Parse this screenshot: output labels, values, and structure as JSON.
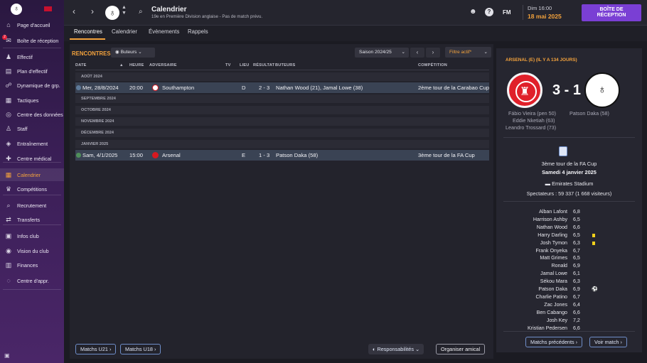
{
  "sidebar": {
    "items": [
      {
        "label": "Page d'accueil",
        "icon": "home-icon",
        "glyph": "⌂"
      },
      {
        "label": "Boîte de réception",
        "icon": "inbox-icon",
        "glyph": "✉",
        "badge": "2"
      },
      {
        "label": "Effectif",
        "icon": "squad-icon",
        "glyph": "♟"
      },
      {
        "label": "Plan d'effectif",
        "icon": "squad-plan-icon",
        "glyph": "▤"
      },
      {
        "label": "Dynamique de grp.",
        "icon": "dynamics-icon",
        "glyph": "☍"
      },
      {
        "label": "Tactiques",
        "icon": "tactics-icon",
        "glyph": "▦"
      },
      {
        "label": "Centre des données",
        "icon": "data-icon",
        "glyph": "◎"
      },
      {
        "label": "Staff",
        "icon": "staff-icon",
        "glyph": "♙"
      },
      {
        "label": "Entraînement",
        "icon": "training-icon",
        "glyph": "◈"
      },
      {
        "label": "Centre médical",
        "icon": "medical-icon",
        "glyph": "✚"
      },
      {
        "label": "Calendrier",
        "icon": "calendar-icon",
        "glyph": "▦"
      },
      {
        "label": "Compétitions",
        "icon": "trophy-icon",
        "glyph": "♛"
      },
      {
        "label": "Recrutement",
        "icon": "scouting-icon",
        "glyph": "⌕"
      },
      {
        "label": "Transferts",
        "icon": "transfers-icon",
        "glyph": "⇄"
      },
      {
        "label": "Infos club",
        "icon": "club-info-icon",
        "glyph": "▣"
      },
      {
        "label": "Vision du club",
        "icon": "club-vision-icon",
        "glyph": "◉"
      },
      {
        "label": "Finances",
        "icon": "finances-icon",
        "glyph": "▥"
      },
      {
        "label": "Centre d'appr.",
        "icon": "learning-icon",
        "glyph": "◌"
      }
    ]
  },
  "topbar": {
    "title": "Calendrier",
    "subtitle": "19e en Première Division anglaise - Pas de match prévu.",
    "fm_label": "FM",
    "time": "Dim 16:00",
    "date": "18 mai 2025",
    "inbox_line1": "BOÎTE DE",
    "inbox_line2": "RÉCEPTION"
  },
  "tabs": [
    "Rencontres",
    "Calendrier",
    "Évènements",
    "Rappels"
  ],
  "fixtures": {
    "section_title": "RENCONTRES",
    "scorers_dropdown": "Buteurs",
    "season_dropdown": "Saison 2024/25",
    "filter_label": "Filtre actif*",
    "columns": {
      "date": "DATE",
      "time": "HEURE",
      "opponent": "ADVERSAIRE",
      "tv": "TV",
      "venue": "LIEU",
      "result": "RÉSULTAT",
      "scorers": "BUTEURS",
      "competition": "COMPÉTITION"
    },
    "months": [
      "AOÛT 2024",
      "SEPTEMBRE 2024",
      "OCTOBRE 2024",
      "NOVEMBRE 2024",
      "DÉCEMBRE 2024",
      "JANVIER 2025"
    ],
    "matches": [
      {
        "date": "Mer, 28/8/2024",
        "time": "20:00",
        "opponent": "Southampton",
        "venue": "D",
        "result": "2 - 3",
        "scorers": "Nathan Wood (21), Jamal Lowe (38)",
        "competition": "2ème tour de la Carabao Cup"
      },
      {
        "date": "Sam, 4/1/2025",
        "time": "15:00",
        "opponent": "Arsenal",
        "venue": "E",
        "result": "1 - 3",
        "scorers": "Patson Daka (58)",
        "competition": "3ème tour de la FA Cup"
      }
    ],
    "btn_u21": "Matchs U21",
    "btn_u18": "Matchs U18",
    "btn_resp": "Responsabilités",
    "btn_friendly": "Organiser amical"
  },
  "detail": {
    "header": "ARSENAL (E) (IL Y A 134 JOURS)",
    "score": "3 - 1",
    "home_scorers": [
      "Fábio Vieira (pen 50)",
      "Eddie Nketiah (63)",
      "Leandro Trossard (73)"
    ],
    "away_scorers": [
      "Patson Daka (58)"
    ],
    "competition": "3ème tour de la FA Cup",
    "date": "Samedi 4 janvier 2025",
    "stadium": "Emirates Stadium",
    "attendance": "Spectateurs : 59 337 (1 668 visiteurs)",
    "lineup": [
      {
        "name": "Alban Lafont",
        "rating": "6,8"
      },
      {
        "name": "Harrison Ashby",
        "rating": "6,5"
      },
      {
        "name": "Nathan Wood",
        "rating": "6,6"
      },
      {
        "name": "Harry Darling",
        "rating": "6,5",
        "card": "yellow"
      },
      {
        "name": "Josh Tymon",
        "rating": "6,3",
        "card": "yellow"
      },
      {
        "name": "Frank Onyeka",
        "rating": "6,7"
      },
      {
        "name": "Matt Grimes",
        "rating": "6,5"
      },
      {
        "name": "Ronald",
        "rating": "6,9"
      },
      {
        "name": "Jamal Lowe",
        "rating": "6,1"
      },
      {
        "name": "Sékou Mara",
        "rating": "6,3"
      },
      {
        "name": "Patson Daka",
        "rating": "6,9",
        "goal": true
      },
      {
        "name": "Charlie Patino",
        "rating": "6,7"
      },
      {
        "name": "Zac Jones",
        "rating": "6,4"
      },
      {
        "name": "Ben Cabango",
        "rating": "6,6"
      },
      {
        "name": "Josh Key",
        "rating": "7,2"
      },
      {
        "name": "Kristian Pedersen",
        "rating": "6,6"
      }
    ],
    "btn_prev": "Matchs précédents",
    "btn_view": "Voir match"
  }
}
